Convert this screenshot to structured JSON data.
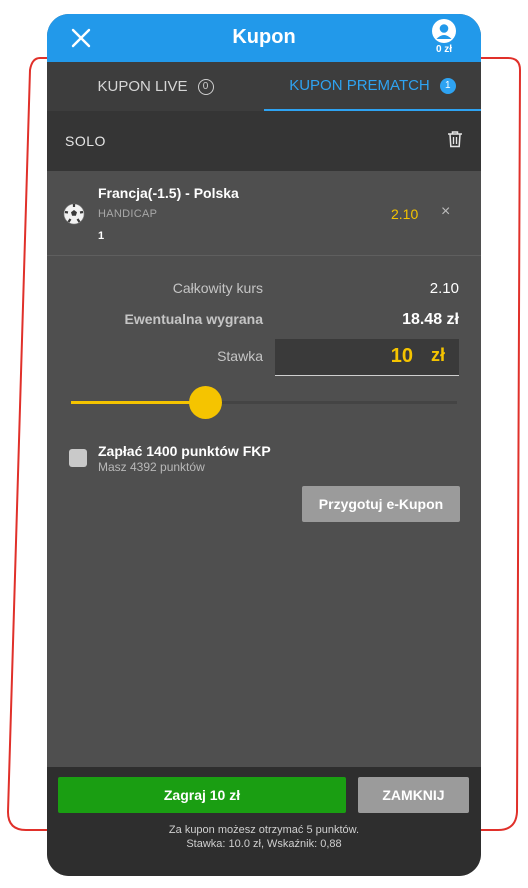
{
  "header": {
    "title": "Kupon",
    "balance": "0 zł"
  },
  "tabs": [
    {
      "label": "KUPON LIVE",
      "count": "0"
    },
    {
      "label": "KUPON PREMATCH",
      "count": "1"
    }
  ],
  "section": {
    "label": "SOLO"
  },
  "bet": {
    "match": "Francja(-1.5) - Polska",
    "market": "HANDICAP",
    "pick": "1",
    "odd": "2.10",
    "remove": "×"
  },
  "summary": {
    "total_odds_label": "Całkowity kurs",
    "total_odds_value": "2.10",
    "potential_win_label": "Ewentualna wygrana",
    "potential_win_value": "18.48 zł",
    "stake_label": "Stawka",
    "stake_value": "10",
    "stake_currency": "zł"
  },
  "slider": {
    "fraction": 0.346
  },
  "fkp": {
    "title": "Zapłać 1400 punktów FKP",
    "subtitle": "Masz 4392 punktów",
    "checked": false
  },
  "ekupon_button": "Przygotuj e-Kupon",
  "footer": {
    "play_button": "Zagraj 10 zł",
    "close_button": "ZAMKNIJ",
    "info_line1": "Za kupon możesz otrzymać 5 punktów.",
    "info_line2": "Stawka: 10.0 zł, Wskaźnik: 0,88"
  },
  "colors": {
    "header_blue": "#2299ea",
    "accent_yellow": "#f5c400",
    "play_green": "#1a9e12",
    "outline_red": "#e0302a"
  }
}
